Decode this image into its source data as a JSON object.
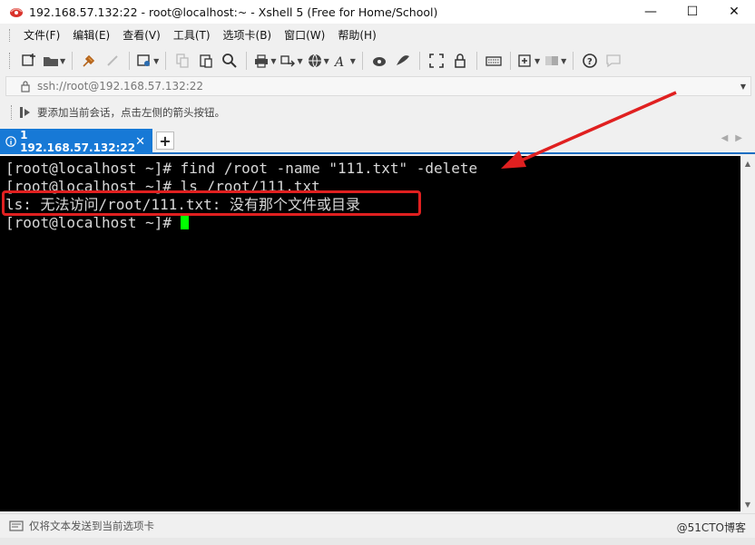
{
  "window": {
    "title": "192.168.57.132:22 - root@localhost:~ - Xshell 5 (Free for Home/School)",
    "minimize": "—",
    "maximize": "☐",
    "close": "✕"
  },
  "menu": {
    "items": [
      "文件(F)",
      "编辑(E)",
      "查看(V)",
      "工具(T)",
      "选项卡(B)",
      "窗口(W)",
      "帮助(H)"
    ]
  },
  "address": {
    "value": "ssh://root@192.168.57.132:22"
  },
  "hint": {
    "text": "要添加当前会话，点击左侧的箭头按钮。"
  },
  "tabs": {
    "active_label": "1 192.168.57.132:22",
    "close": "✕",
    "add": "+"
  },
  "terminal": {
    "lines": [
      "[root@localhost ~]# find /root -name \"111.txt\" -delete",
      "[root@localhost ~]# ls /root/111.txt",
      "ls: 无法访问/root/111.txt: 没有那个文件或目录",
      "[root@localhost ~]# "
    ]
  },
  "sendbar": {
    "text": "仅将文本发送到当前选项卡"
  },
  "watermark": "@51CTO博客",
  "colors": {
    "tab_active": "#1779d6",
    "annotation_red": "#e02020",
    "cursor": "#00ff00",
    "terminal_bg": "#000000"
  }
}
